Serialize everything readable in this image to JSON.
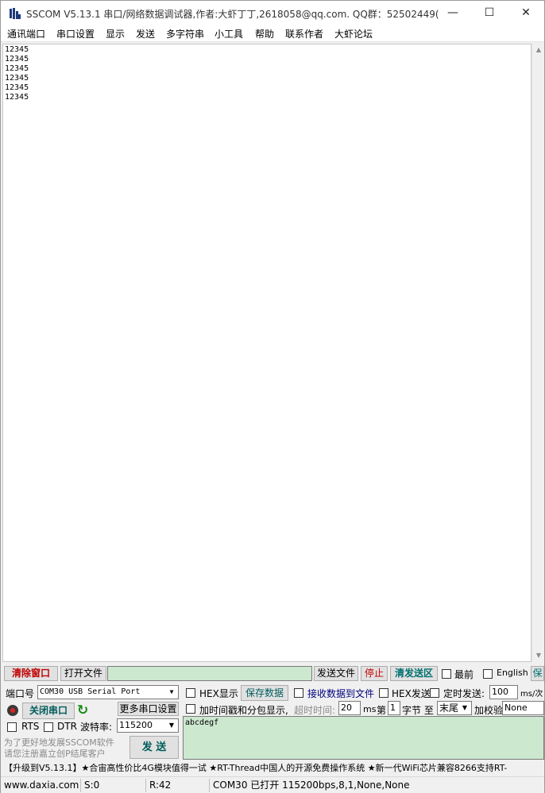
{
  "window": {
    "title": "SSCOM V5.13.1 串口/网络数据调试器,作者:大虾丁丁,2618058@qq.com. QQ群：52502449(...",
    "min_glyph": "—",
    "max_glyph": "☐",
    "close_glyph": "✕"
  },
  "menu": {
    "items": [
      "通讯端口",
      "串口设置",
      "显示",
      "发送",
      "多字符串",
      "小工具",
      "帮助",
      "联系作者",
      "大虾论坛"
    ]
  },
  "receive": {
    "lines": [
      "12345",
      "12345",
      "12345",
      "12345",
      "12345",
      "12345"
    ]
  },
  "toolbar": {
    "clear_label": "清除窗口",
    "open_file_label": "打开文件",
    "file_path_value": "",
    "send_file_label": "发送文件",
    "stop_label": "停止",
    "clear_send_label": "清发送区",
    "topmost_label": "最前",
    "english_label": "English",
    "save_partial_label": "保"
  },
  "port": {
    "port_label": "端口号",
    "port_value": "COM30 USB Serial Port",
    "close_port_label": "关闭串口",
    "more_settings_label": "更多串口设置",
    "rts_label": "RTS",
    "dtr_label": "DTR",
    "baud_label": "波特率:",
    "baud_value": "115200",
    "promo_hint_line1": "为了更好地发展SSCOM软件",
    "promo_hint_line2": "请您注册嘉立创P结尾客户",
    "send_label": "发  送"
  },
  "options": {
    "hex_display_label": "HEX显示",
    "save_data_label": "保存数据",
    "recv_to_file_label": "接收数据到文件",
    "hex_send_label": "HEX发送",
    "timed_send_label": "定时发送:",
    "timed_send_value": "100",
    "timed_unit": "ms/次",
    "timestamp_label": "加时间戳和分包显示,",
    "timeout_label": "超时时间:",
    "timeout_value": "20",
    "timeout_unit": "ms",
    "nth_label": "第",
    "nth_value": "1",
    "byte_to_label": "字节 至",
    "end_value": "末尾",
    "checksum_label": "加校验",
    "checksum_value": "None"
  },
  "send_area": {
    "text": "abcdegf"
  },
  "promo_bar": {
    "text": "【升级到V5.13.1】★合宙高性价比4G模块值得一试 ★RT-Thread中国人的开源免费操作系统 ★新一代WiFi芯片兼容8266支持RT-"
  },
  "status": {
    "site": "www.daxia.com",
    "sent": "S:0",
    "received": "R:42",
    "port_state": "COM30 已打开  115200bps,8,1,None,None"
  },
  "colors": {
    "send_area_bg": "#cce8cf",
    "clear_red": "#c00000",
    "teal": "#007070"
  }
}
